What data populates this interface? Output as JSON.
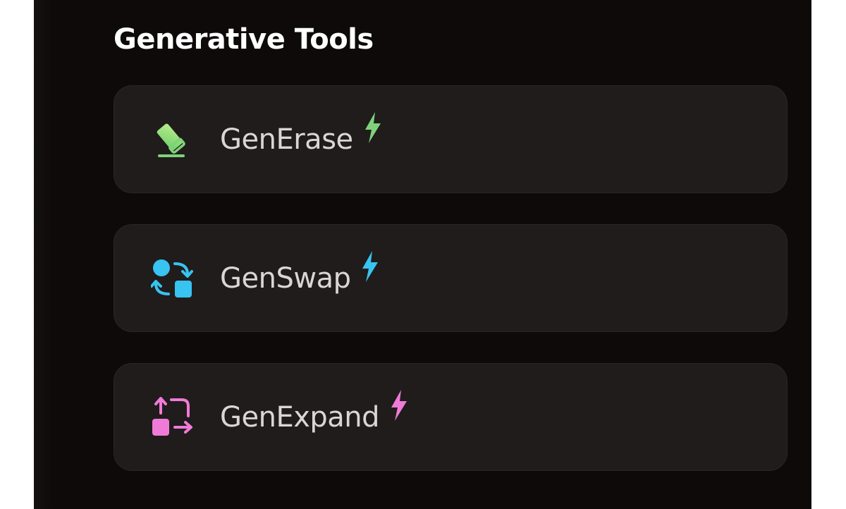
{
  "section": {
    "title": "Generative Tools"
  },
  "tools": [
    {
      "label": "GenErase",
      "icon": "eraser-icon",
      "accent": "#7fd27a"
    },
    {
      "label": "GenSwap",
      "icon": "swap-icon",
      "accent": "#38c3f0"
    },
    {
      "label": "GenExpand",
      "icon": "expand-icon",
      "accent": "#f07ad8"
    }
  ]
}
